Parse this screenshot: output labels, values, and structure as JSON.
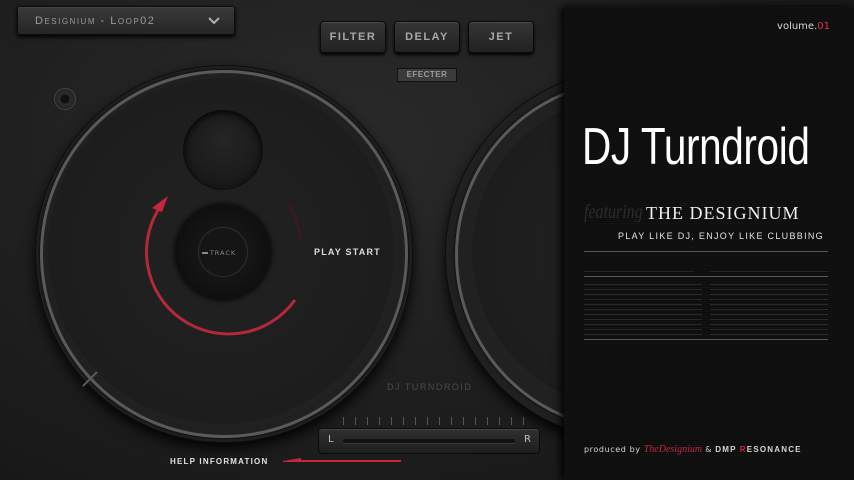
{
  "loop_selector": {
    "value": "Designium - Loop02",
    "icon": "chevron-down-icon"
  },
  "effects": {
    "buttons": [
      "FILTER",
      "DELAY",
      "JET"
    ],
    "label": "EFECTER"
  },
  "deck": {
    "track_label": "TRACK",
    "play_start": "PLAY START",
    "brand": "DJ TURNDROID"
  },
  "crossfader": {
    "left": "L",
    "right": "R"
  },
  "help": {
    "label": "HELP INFORMATION"
  },
  "cover": {
    "volume_prefix": "volume.",
    "volume_number": "01",
    "title": "DJ Turndroid",
    "featuring": "featuring",
    "subtitle": "THE DESIGNIUM",
    "tagline": "PLAY LIKE DJ, ENJOY LIKE CLUBBING",
    "credits": {
      "produced_by": "produced by",
      "brand": "TheDesignium",
      "amp": "&",
      "dmp": "DMP",
      "resonance_first": "R",
      "resonance_rest": "ESONANCE"
    }
  },
  "colors": {
    "accent": "#c4283a",
    "background": "#1e1e1e",
    "panel": "#101010"
  }
}
